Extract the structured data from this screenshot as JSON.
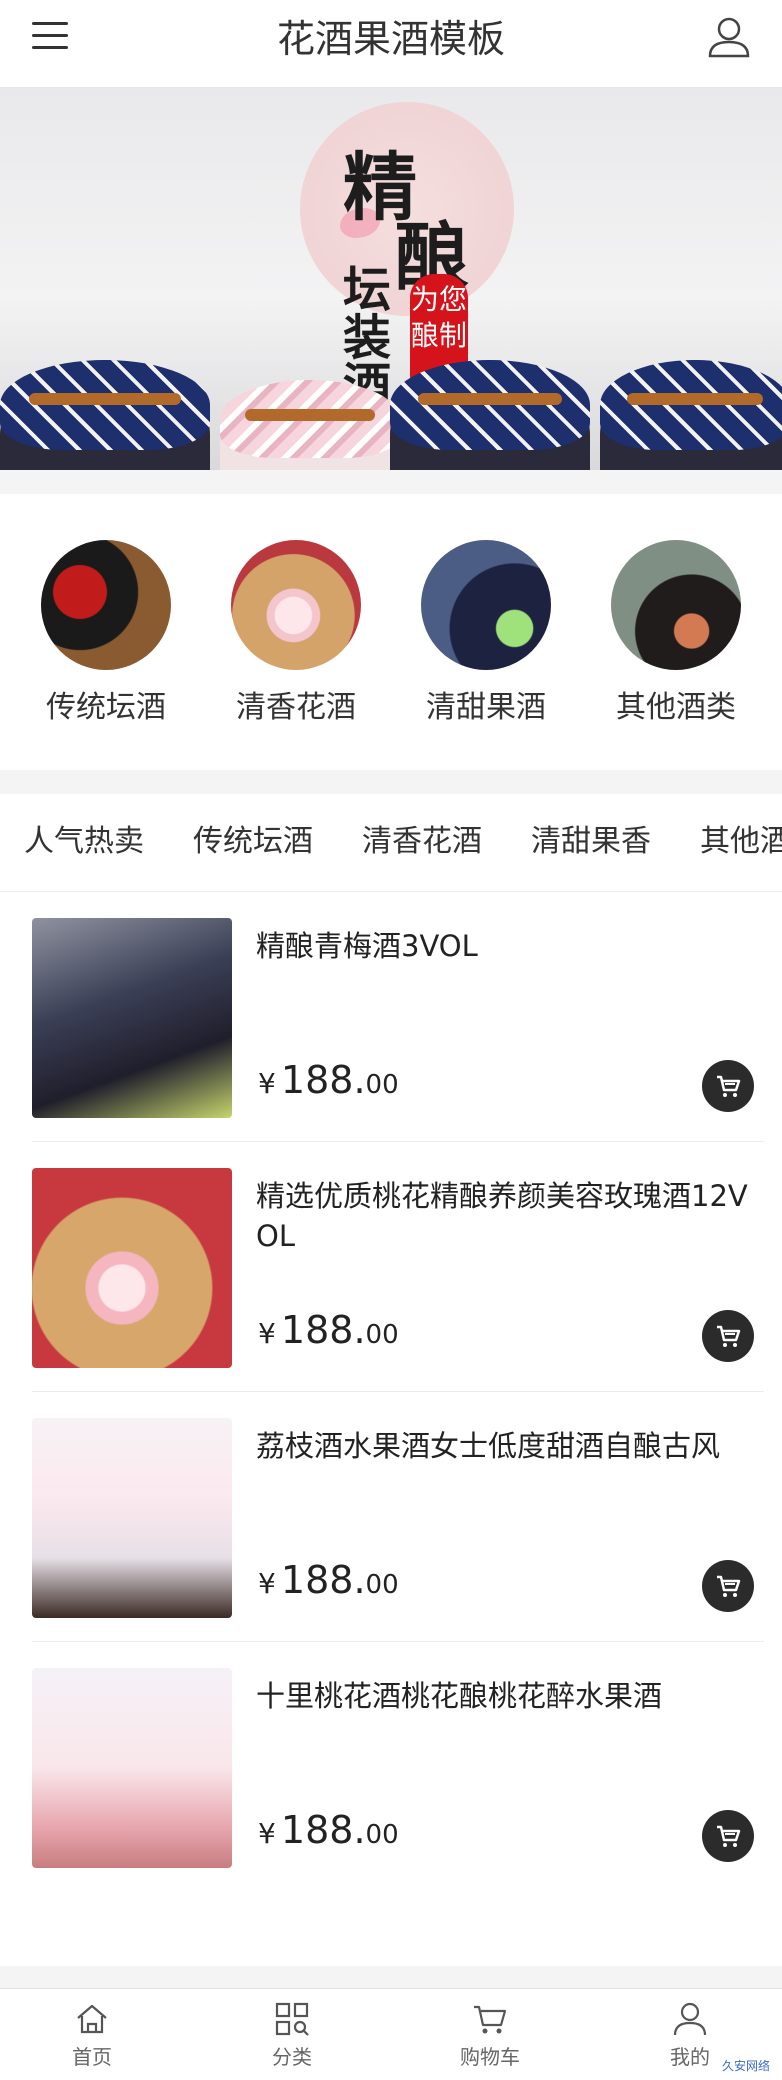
{
  "header": {
    "title": "花酒果酒模板",
    "menu_icon": "hamburger-menu-icon",
    "user_icon": "user-icon"
  },
  "banner": {
    "chars": [
      "精",
      "酿",
      "坛",
      "装",
      "酒"
    ],
    "stamp_text": "为您酿制"
  },
  "categories": [
    {
      "label": "传统坛酒"
    },
    {
      "label": "清香花酒"
    },
    {
      "label": "清甜果酒"
    },
    {
      "label": "其他酒类"
    }
  ],
  "tabs": [
    {
      "label": "人气热卖"
    },
    {
      "label": "传统坛酒"
    },
    {
      "label": "清香花酒"
    },
    {
      "label": "清甜果香"
    },
    {
      "label": "其他酒"
    }
  ],
  "products": [
    {
      "name": "精酿青梅酒3VOL",
      "currency": "¥",
      "price_int": "188.",
      "price_dec": "00"
    },
    {
      "name": "精选优质桃花精酿养颜美容玫瑰酒12VOL",
      "currency": "¥",
      "price_int": "188.",
      "price_dec": "00"
    },
    {
      "name": "荔枝酒水果酒女士低度甜酒自酿古风",
      "currency": "¥",
      "price_int": "188.",
      "price_dec": "00"
    },
    {
      "name": "十里桃花酒桃花酿桃花醉水果酒",
      "currency": "¥",
      "price_int": "188.",
      "price_dec": "00"
    }
  ],
  "bottom_nav": [
    {
      "label": "首页",
      "icon": "home-icon"
    },
    {
      "label": "分类",
      "icon": "category-icon"
    },
    {
      "label": "购物车",
      "icon": "cart-icon"
    },
    {
      "label": "我的",
      "icon": "user-icon"
    }
  ],
  "watermark": "久安网络"
}
